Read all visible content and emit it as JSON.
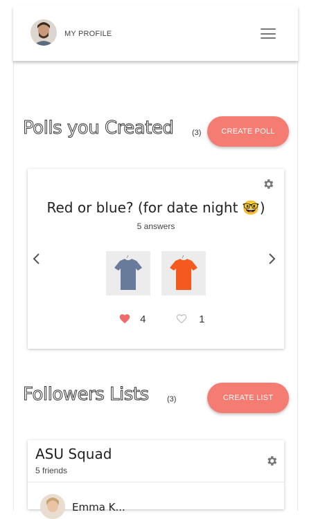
{
  "header": {
    "profile_label": "MY PROFILE"
  },
  "polls": {
    "title": "Polls you Created",
    "count": "(3)",
    "create_button": "CREATE POLL",
    "card": {
      "question": "Red or blue? (for date night 🤓)",
      "answers": "5 answers",
      "options": [
        {
          "color": "blue",
          "shirt_color": "#687b9b",
          "votes": "4",
          "liked": true
        },
        {
          "color": "red",
          "shirt_color": "#f45a1f",
          "votes": "1",
          "liked": false
        }
      ]
    }
  },
  "followers": {
    "title": "Followers Lists",
    "count": "(3)",
    "create_button": "CREATE LIST",
    "card": {
      "name": "ASU Squad",
      "friends": "5 friends",
      "first_member": "Emma K..."
    }
  },
  "colors": {
    "accent": "#f57c73",
    "heart": "#ef6b6b"
  },
  "icons": [
    "menu-icon",
    "gear-icon",
    "chevron-left-icon",
    "chevron-right-icon",
    "heart-filled-icon",
    "heart-outline-icon"
  ]
}
